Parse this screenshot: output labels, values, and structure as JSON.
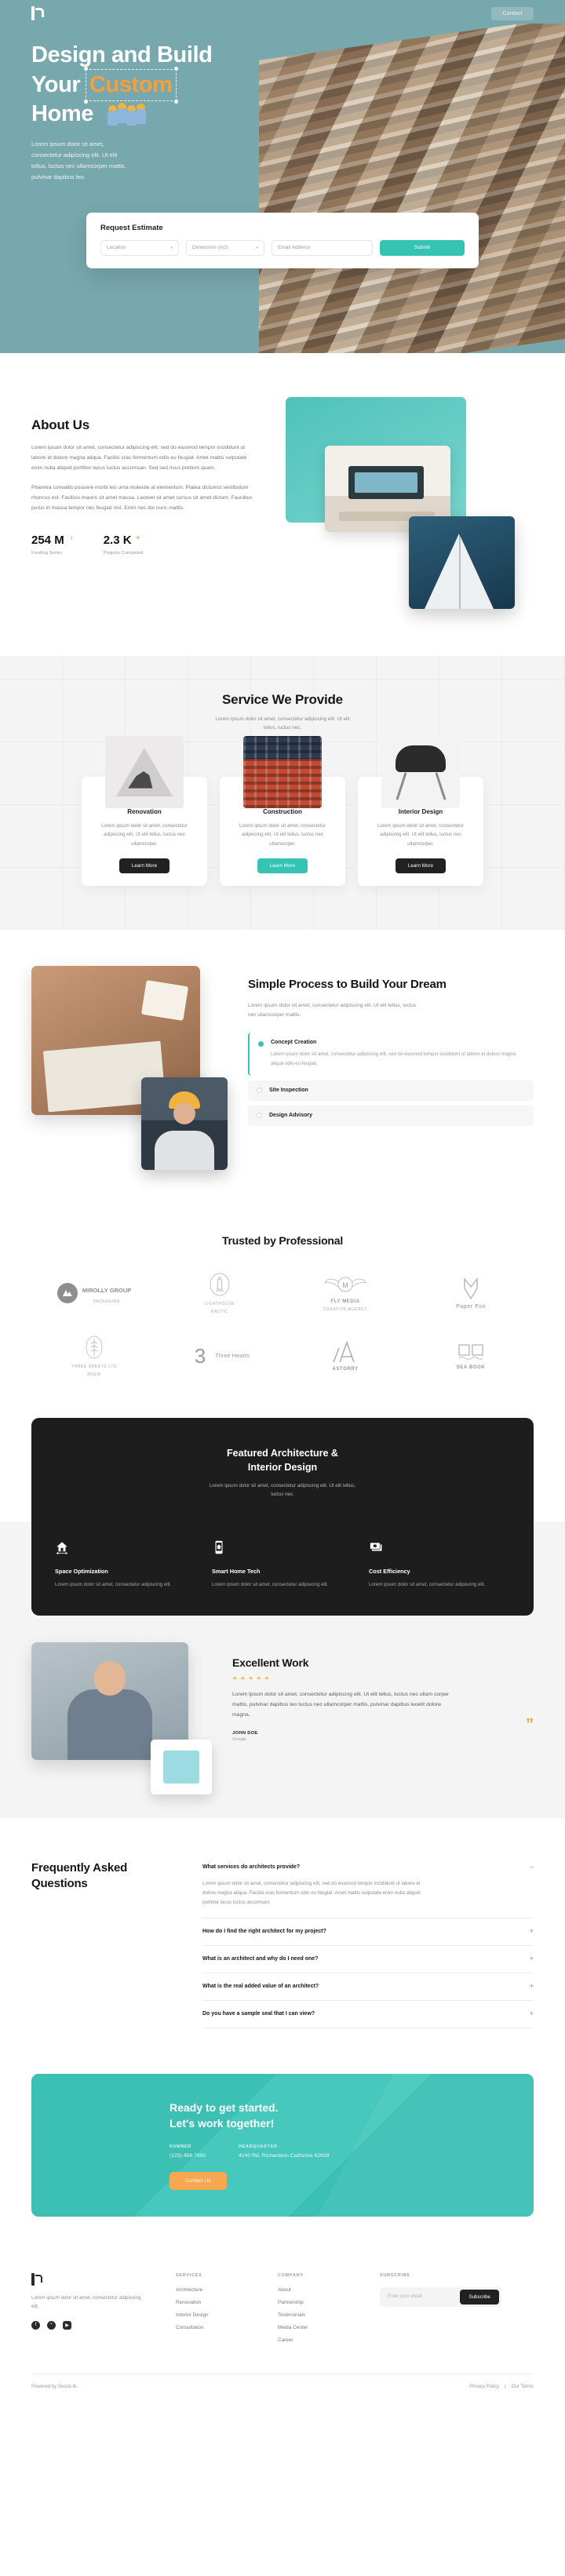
{
  "nav": {
    "contact_label": "Contact",
    "logo_name": "architecture-logo"
  },
  "hero": {
    "title_line1": "Design and Build",
    "title_line2_prefix": "Your",
    "title_line2_highlight": "Custom",
    "title_line3": "Home",
    "paragraph": "Lorem ipsum dolor sit amet, consectetur adipiscing elit. Ut elit tellus, luctus nec ullamcorper mattis, pulvinar dapibus leo.",
    "highlight_color": "#f5a03f",
    "bg_color": "#77a8ad"
  },
  "estimate": {
    "title": "Request Estimate",
    "location_value": "Location",
    "dimension_value": "Dimension (m2)",
    "email_placeholder": "Email Address",
    "submit_label": "Submit",
    "submit_color": "#35c3b4"
  },
  "about": {
    "title": "About Us",
    "paragraph1": "Lorem ipsum dolor sit amet, consectetur adipiscing elit, sed do eiusmod tempor incididunt ut labore et dolore magna aliqua. Facilisi cras fermentum odio eu feugiat. Amet mattis vulputate enim nulla aliquet porttitor lacus luctus accumsan. Sed sed risus pretium quam.",
    "paragraph2": "Pharetra convallis posuere morbi leo urna molestie at elementum. Platea dictumst vestibulum rhoncus est. Facilisis mauris sit amet massa. Laoreet sit amet cursus sit amet dictum. Faucibus purus in massa tempor nec feugiat nisl. Enim nec dui nunc mattis.",
    "stats": [
      {
        "number": "254 M",
        "sup": "›",
        "label": "Funding Series"
      },
      {
        "number": "2.3 K",
        "sup": "+",
        "label": "Projects Completed"
      }
    ]
  },
  "services": {
    "title": "Service We Provide",
    "subtitle": "Lorem ipsum dolor sit amet, consectetur adipiscing elit. Ut elit tellus, luctus nec.",
    "cards": [
      {
        "title": "Renovation",
        "text": "Lorem ipsum dolor sit amet, consectetur adipiscing elit. Ut elit tellus, luctus nec ullamcorper.",
        "button": "Learn More",
        "image_name": "renovation-sign-image"
      },
      {
        "title": "Construction",
        "text": "Lorem ipsum dolor sit amet, consectetur adipiscing elit. Ut elit tellus, luctus nec ullamcorper.",
        "button": "Learn More",
        "image_name": "construction-building-image"
      },
      {
        "title": "Interior Design",
        "text": "Lorem ipsum dolor sit amet, consectetur adipiscing elit. Ut elit tellus, luctus nec ullamcorper.",
        "button": "Learn More",
        "image_name": "interior-chair-image"
      }
    ]
  },
  "process": {
    "title": "Simple Process to Build Your Dream",
    "paragraph": "Lorem ipsum dolor sit amet, consectetur adipiscing elit. Ut elit tellus, luctus nec ullamcorper mattis.",
    "steps": [
      {
        "title": "Concept Creation",
        "text": "Lorem ipsum dolor sit amet, consectetur adipiscing elit, sed do eiusmod tempor incididunt ut labore et dolore magna aliqua odio eu feugiat.",
        "active": true
      },
      {
        "title": "Site Inspection",
        "active": false
      },
      {
        "title": "Design Advisory",
        "active": false
      }
    ]
  },
  "trusted": {
    "title": "Trusted by Professional",
    "logos": [
      {
        "name": "MIROLLY GROUP",
        "caption": "PACKAGING"
      },
      {
        "name": "LIGHTHOUSE",
        "caption": "NAUTIC"
      },
      {
        "name": "FLY MEDIA",
        "caption": "CREATIVE AGENCY"
      },
      {
        "name": "Paper Fox",
        "caption": ""
      },
      {
        "name": "THREE SHEETS LTD",
        "caption": "BREW"
      },
      {
        "name": "Three Hearts",
        "caption": ""
      },
      {
        "name": "ASTORRY",
        "caption": ""
      },
      {
        "name": "SEA BOOK",
        "caption": ""
      }
    ]
  },
  "featured": {
    "title_line1": "Featured Architecture &",
    "title_line2": "Interior Design",
    "subtitle": "Lorem ipsum dolor sit amet, consectetur adipiscing elit. Ut elit tellus, luctus nec.",
    "items": [
      {
        "title": "Space Optimization",
        "text": "Lorem ipsum dolor sit amet, consectetur adipiscing elit.",
        "icon": "house-arrow-icon"
      },
      {
        "title": "Smart Home Tech",
        "text": "Lorem ipsum dolor sit amet, consectetur adipiscing elit.",
        "icon": "phone-home-icon"
      },
      {
        "title": "Cost Efficiency",
        "text": "Lorem ipsum dolor sit amet, consectetur adipiscing elit.",
        "icon": "money-icon"
      }
    ]
  },
  "testimonial": {
    "title": "Excellent Work",
    "stars": "★ ★ ★ ★ ★",
    "quote": "Lorem ipsum dolor sit amet, consectetur adipiscing elit. Ut elit tellus, luctus nec ullam corper mattis, pulvinar dapibus leo luctus nec ullamcorper mattis, pulvinar dapibus leoelit dolore magna.",
    "author": "JOHN DOE",
    "org": "Google",
    "quote_mark": "”"
  },
  "faq": {
    "title": "Frequently Asked Questions",
    "items": [
      {
        "question": "What services do architects provide?",
        "icon": "–",
        "answer": "Lorem ipsum dolor sit amet, consectetur adipiscing elit, sed do eiusmod tempor incididunt ut labore et dolore magna aliqua. Facilisi cras fermentum odio eu feugiat. Amet mattis vulputate enim nulla aliquet porttitor lacus luctus accumsan."
      },
      {
        "question": "How do I find the right architect for my project?",
        "icon": "+",
        "answer": ""
      },
      {
        "question": "What is an architect and why do I need one?",
        "icon": "+",
        "answer": ""
      },
      {
        "question": "What is the real added value of an architect?",
        "icon": "+",
        "answer": ""
      },
      {
        "question": "Do you have a sample seal that I can view?",
        "icon": "+",
        "answer": ""
      }
    ]
  },
  "cta": {
    "title_line1": "Ready to get started.",
    "title_line2": "Let's work together!",
    "number_label": "NUMBER",
    "number_value": "(123) 456 7890",
    "hq_label": "HEADQUARTER",
    "hq_value": "4140 Rd. Richardson California 62639",
    "button": "Contact Us",
    "bg_color": "#3cc0b4",
    "button_color": "#f8a751"
  },
  "footer": {
    "description": "Lorem ipsum dolor sit amet, consectetur adipiscing elit.",
    "socials": [
      {
        "name": "facebook-icon",
        "glyph": "f"
      },
      {
        "name": "twitter-icon",
        "glyph": "ᵛ"
      },
      {
        "name": "youtube-icon",
        "glyph": "▶"
      }
    ],
    "services": {
      "heading": "SERVICES",
      "links": [
        "Architecture",
        "Renovation",
        "Interior Design",
        "Consultation"
      ]
    },
    "company": {
      "heading": "COMPANY",
      "links": [
        "About",
        "Partnership",
        "Testimonials",
        "Media Center",
        "Career"
      ]
    },
    "subscribe": {
      "heading": "SUBSCRIBE",
      "placeholder": "Enter your email",
      "button": "Subscribe"
    },
    "powered_by": "Powered by SocioLib.",
    "privacy": "Privacy Policy",
    "terms": "Our Terms",
    "separator": "|"
  }
}
